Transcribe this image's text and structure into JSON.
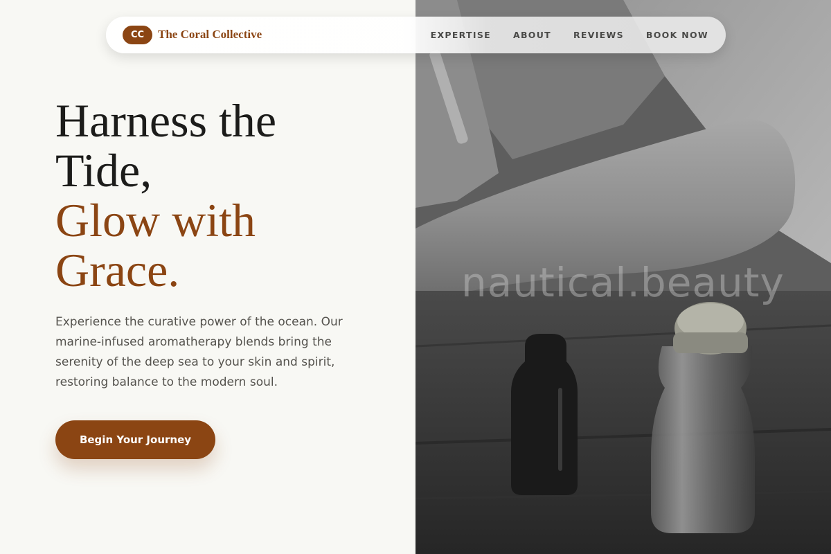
{
  "nav": {
    "logo_initials": "CC",
    "brand_name": "The Coral Collective",
    "links": [
      {
        "label": "EXPERTISE"
      },
      {
        "label": "ABOUT"
      },
      {
        "label": "REVIEWS"
      },
      {
        "label": "BOOK NOW"
      }
    ]
  },
  "hero": {
    "title_line1": "Harness the",
    "title_line2": "Tide,",
    "title_accent_line1": "Glow with",
    "title_accent_line2": "Grace.",
    "description": "Experience the curative power of the ocean. Our marine-infused aromatherapy blends bring the serenity of the deep sea to your skin and spirit, restoring balance to the modern soul.",
    "cta_label": "Begin Your Journey"
  },
  "photo": {
    "watermark": "nautical.beauty"
  },
  "colors": {
    "accent": "#8b4513",
    "background": "#f8f8f4",
    "heading": "#1c1c1a",
    "body_text": "#55534e"
  }
}
